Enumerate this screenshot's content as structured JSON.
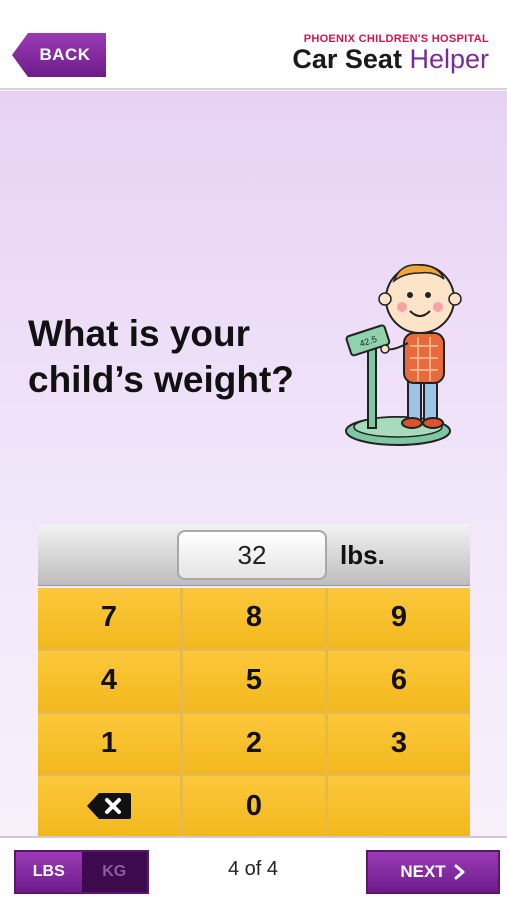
{
  "header": {
    "back_label": "BACK",
    "logo_org": "PHOENIX CHILDREN'S HOSPITAL",
    "logo_app_word1": "Car Seat",
    "logo_app_word2": "Helper"
  },
  "main": {
    "question": "What is your child’s weight?",
    "illustration_scale_reading": "42.5"
  },
  "keypad": {
    "display_value": "32",
    "unit_label": "lbs.",
    "keys": [
      "7",
      "8",
      "9",
      "4",
      "5",
      "6",
      "1",
      "2",
      "3",
      "",
      "0",
      ""
    ]
  },
  "footer": {
    "unit_toggle": {
      "lbs": "LBS",
      "kg": "KG",
      "selected": "LBS"
    },
    "page_indicator": "4 of 4",
    "next_label": "NEXT"
  },
  "colors": {
    "accent_purple": "#7a2c96",
    "brand_red": "#d4144a",
    "key_yellow": "#fcc83a",
    "background_lavender": "#e7d2f4"
  },
  "icons": {
    "delete": "backspace-icon",
    "next": "chevron-right-icon"
  }
}
